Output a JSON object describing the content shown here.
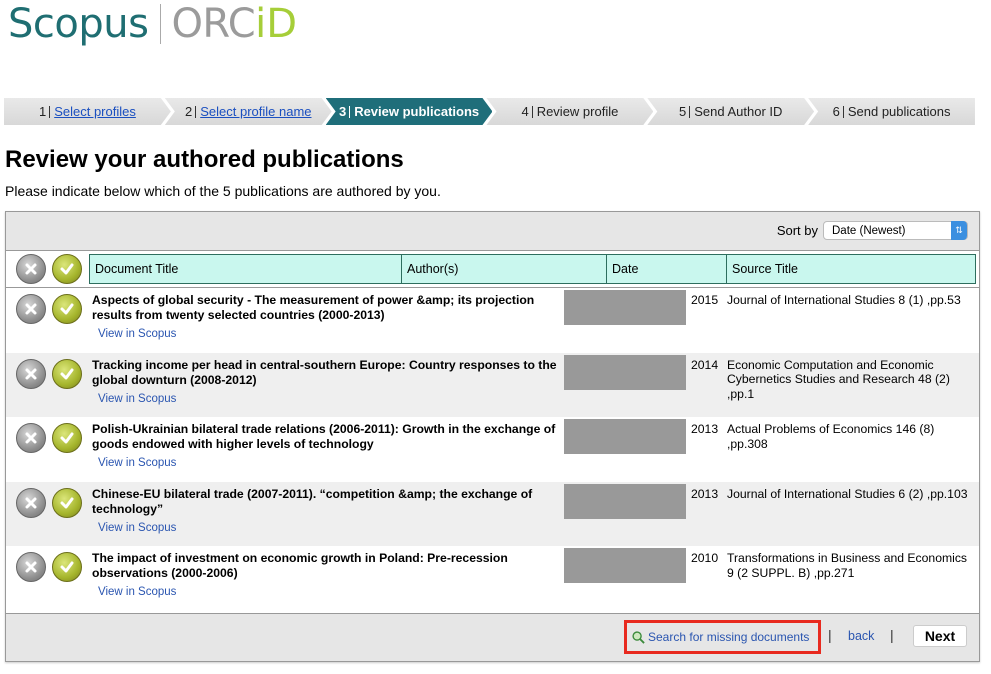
{
  "logo": {
    "left": "Scopus",
    "right_main": "ORC",
    "right_accent": "iD"
  },
  "steps": [
    {
      "num": "1",
      "label": "Select profiles",
      "link": true,
      "active": false
    },
    {
      "num": "2",
      "label": "Select profile name",
      "link": true,
      "active": false
    },
    {
      "num": "3",
      "label": "Review publications",
      "link": false,
      "active": true
    },
    {
      "num": "4",
      "label": "Review profile",
      "link": false,
      "active": false
    },
    {
      "num": "5",
      "label": "Send Author ID",
      "link": false,
      "active": false
    },
    {
      "num": "6",
      "label": "Send publications",
      "link": false,
      "active": false
    }
  ],
  "heading": "Review your authored publications",
  "intro": "Please indicate below which of the 5 publications are authored by you.",
  "sort": {
    "label": "Sort by",
    "value": "Date (Newest)"
  },
  "columns": [
    "Document Title",
    "Author(s)",
    "Date",
    "Source Title"
  ],
  "publications": [
    {
      "title": "Aspects of global security - The measurement of power &amp; its projection results from twenty selected countries (2000-2013)",
      "link": "View in Scopus",
      "date": "2015",
      "source": "Journal of International Studies 8 (1) ,pp.53"
    },
    {
      "title": "Tracking income per head in central-southern Europe: Country responses to the global downturn (2008-2012)",
      "link": "View in Scopus",
      "date": "2014",
      "source": "Economic Computation and Economic Cybernetics Studies and Research 48 (2) ,pp.1"
    },
    {
      "title": "Polish-Ukrainian bilateral trade relations (2006-2011): Growth in the exchange of goods endowed with higher levels of technology",
      "link": "View in Scopus",
      "date": "2013",
      "source": "Actual Problems of Economics 146 (8) ,pp.308"
    },
    {
      "title": "Chinese-EU bilateral trade (2007-2011). “competition &amp; the exchange of technology”",
      "link": "View in Scopus",
      "date": "2013",
      "source": "Journal of International Studies 6 (2) ,pp.103"
    },
    {
      "title": "The impact of investment on economic growth in Poland: Pre-recession observations (2000-2006)",
      "link": "View in Scopus",
      "date": "2010",
      "source": "Transformations in Business and Economics 9 (2 SUPPL. B) ,pp.271"
    }
  ],
  "footer": {
    "search_missing": "Search for missing documents",
    "separator": "|",
    "back": "back",
    "next": "Next"
  },
  "colors": {
    "brand_teal": "#1f6e7a",
    "orcid_green": "#a6ce39",
    "header_cyan": "#c9f7ee",
    "highlight_red": "#e82a1f",
    "link_blue": "#2a55b0"
  }
}
